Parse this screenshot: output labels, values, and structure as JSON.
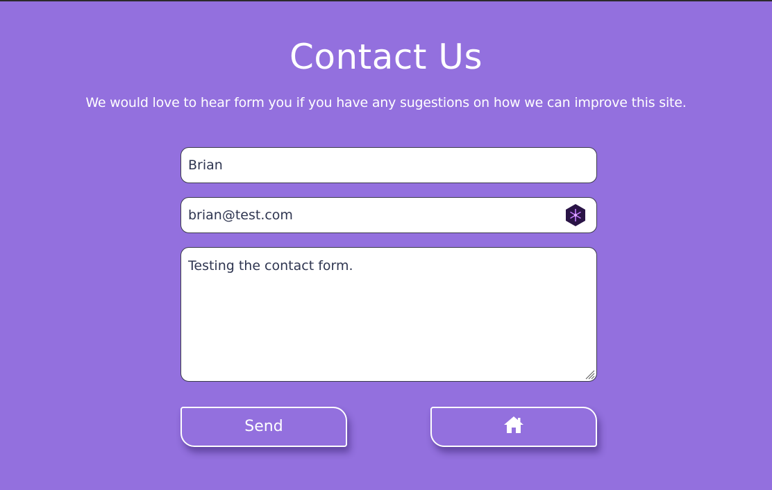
{
  "header": {
    "title": "Contact Us",
    "subtitle": "We would love to hear form you if you have any sugestions on how we can improve this site."
  },
  "form": {
    "name_value": "Brian",
    "email_value": "brian@test.com",
    "message_value": "Testing the contact form.",
    "send_label": "Send",
    "home_icon": "home-icon",
    "extension_icon": "password-manager-icon"
  },
  "colors": {
    "background": "#9370de",
    "field_background": "#ffffff",
    "text_in_fields": "#2e3550",
    "extension_icon_bg": "#2a1446",
    "extension_icon_accent": "#c77dff"
  }
}
